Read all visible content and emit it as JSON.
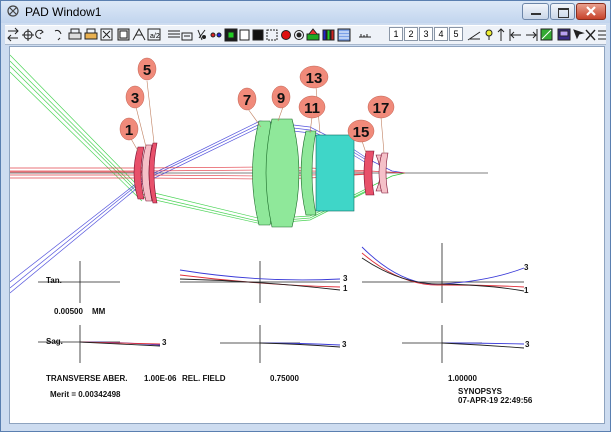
{
  "window": {
    "title": "PAD Window1",
    "controls": [
      "minimize",
      "restore",
      "close"
    ]
  },
  "toolbar": {
    "icons": [
      "swap-icon",
      "target-icon",
      "undo-icon",
      "redo-icon",
      "print-icon",
      "print-setup-icon",
      "zoom-icon",
      "frame-icon",
      "split-icon",
      "calc-icon",
      "grid-icon",
      "lens-icon",
      "scatter-icon",
      "dots-icon",
      "square-icon",
      "blank-icon",
      "fill-icon",
      "dotted-icon",
      "record-icon",
      "stop-icon",
      "color-icon",
      "bars-icon",
      "hatch-icon",
      "ruler-icon"
    ],
    "numbers": [
      "1",
      "2",
      "3",
      "4",
      "5"
    ],
    "right_icons": [
      "slope-icon",
      "bulb-icon",
      "up-arrow-icon",
      "left-bar-icon",
      "right-bar-icon",
      "image-icon",
      "monitor-icon",
      "pointer-icon",
      "close-x-icon",
      "menu-lines-icon"
    ]
  },
  "surfaces": [
    "1",
    "3",
    "5",
    "7",
    "9",
    "11",
    "13",
    "15",
    "17"
  ],
  "aberrations": {
    "tan_label": "Tan.",
    "sag_label": "Sag.",
    "scale_value": "0.00500",
    "scale_unit": "MM",
    "curve_marks": {
      "a": "3",
      "b": "1"
    },
    "transverse_label": "TRANSVERSE ABER.",
    "transverse_value": "1.00E-06",
    "rel_field_label": "REL. FIELD",
    "fields": [
      "0.75000",
      "1.00000"
    ],
    "merit": "Merit = 0.00342498",
    "company": "SYNOPSYS",
    "timestamp": "07-APR-19  22:49:56"
  },
  "colors": {
    "blue_ray": "#3a3ad8",
    "green_ray": "#2dcc3a",
    "red_ray": "#e0303a",
    "lens_green": "#8fe89a",
    "lens_cyan": "#3fd6c8",
    "lens_red": "#e8506a",
    "badge": "#f08a7a"
  }
}
